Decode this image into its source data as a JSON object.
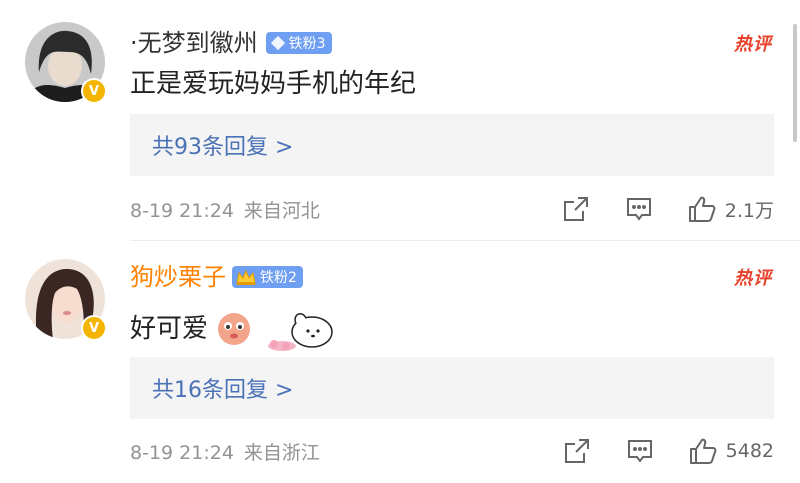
{
  "comments": [
    {
      "username": "·无梦到徽州",
      "fan_badge": "铁粉3",
      "hot_label": "热评",
      "content": "正是爱玩妈妈手机的年纪",
      "replies": "共93条回复 >",
      "date": "8-19 21:24",
      "location": "来自河北",
      "likes": "2.1万",
      "avatar_icon": "avatar-photo",
      "verified_icon": "verified-v"
    },
    {
      "username": "狗炒栗子",
      "fan_badge": "铁粉2",
      "hot_label": "热评",
      "content": "好可爱",
      "replies": "共16条回复 >",
      "date": "8-19 21:24",
      "location": "来自浙江",
      "likes": "5482",
      "avatar_icon": "avatar-photo",
      "verified_icon": "verified-v"
    }
  ],
  "colors": {
    "accent_name": "#ff8200",
    "fan_badge": "#6f9ff2",
    "hot": "#e8412c",
    "reply_link": "#4a72b6",
    "verified": "#f4b400"
  }
}
